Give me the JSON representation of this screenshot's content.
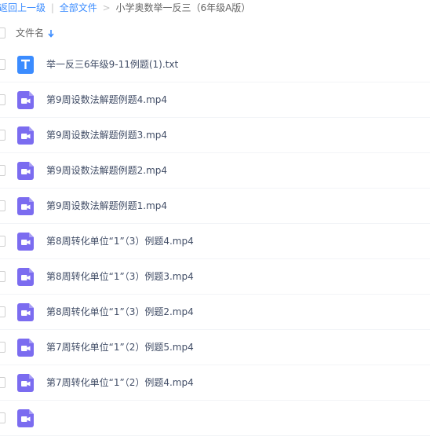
{
  "breadcrumb": {
    "back_label": "返回上一级",
    "all_files_label": "全部文件",
    "separator": ">",
    "current_folder": "小学奥数举一反三（6年级A版）"
  },
  "header": {
    "column_name": "文件名"
  },
  "colors": {
    "txt_icon": "#3b8cff",
    "video_icon": "#7b6cf0",
    "link": "#3b8cff"
  },
  "files": [
    {
      "name": "举一反三6年级9-11例题(1).txt",
      "icon": "text-file-icon"
    },
    {
      "name": "第9周设数法解题例题4.mp4",
      "icon": "video-file-icon"
    },
    {
      "name": "第9周设数法解题例题3.mp4",
      "icon": "video-file-icon"
    },
    {
      "name": "第9周设数法解题例题2.mp4",
      "icon": "video-file-icon"
    },
    {
      "name": "第9周设数法解题例题1.mp4",
      "icon": "video-file-icon"
    },
    {
      "name": "第8周转化单位“1”（3）例题4.mp4",
      "icon": "video-file-icon"
    },
    {
      "name": "第8周转化单位“1”（3）例题3.mp4",
      "icon": "video-file-icon"
    },
    {
      "name": "第8周转化单位“1”（3）例题2.mp4",
      "icon": "video-file-icon"
    },
    {
      "name": "第7周转化单位“1”（2）例题5.mp4",
      "icon": "video-file-icon"
    },
    {
      "name": "第7周转化单位“1”（2）例题4.mp4",
      "icon": "video-file-icon"
    },
    {
      "name": "",
      "icon": "video-file-icon"
    }
  ]
}
